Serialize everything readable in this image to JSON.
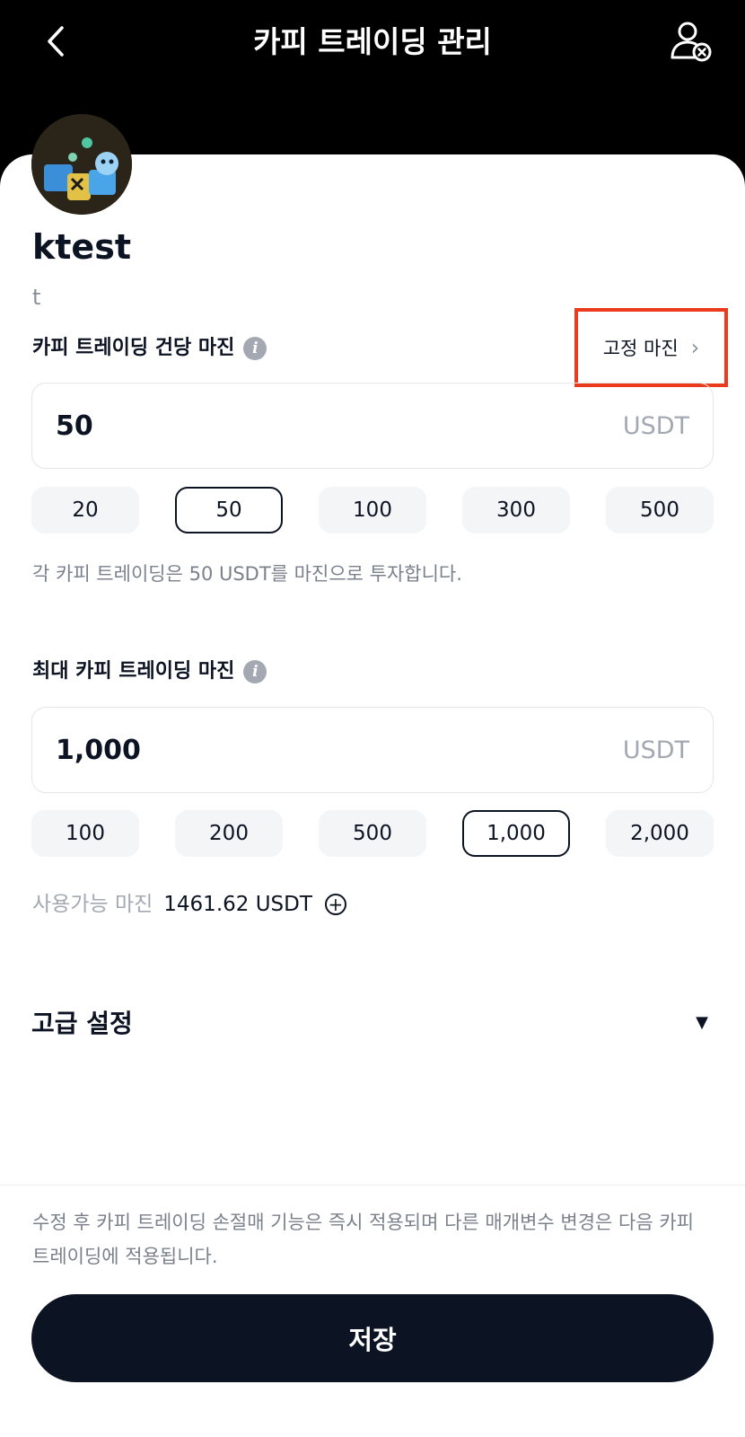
{
  "header": {
    "title": "카피 트레이딩 관리",
    "back_icon": "chevron-left-icon",
    "unfollow_icon": "user-remove-icon"
  },
  "trader": {
    "name": "ktest",
    "description": "t"
  },
  "per_trade_margin": {
    "label": "카피 트레이딩 건당 마진",
    "mode": "고정 마진",
    "value": "50",
    "unit": "USDT",
    "presets": [
      "20",
      "50",
      "100",
      "300",
      "500"
    ],
    "selected": "50",
    "helper": "각 카피 트레이딩은 50 USDT를 마진으로 투자합니다."
  },
  "max_margin": {
    "label": "최대 카피 트레이딩 마진",
    "value": "1,000",
    "unit": "USDT",
    "presets": [
      "100",
      "200",
      "500",
      "1,000",
      "2,000"
    ],
    "selected": "1,000"
  },
  "available": {
    "label": "사용가능 마진",
    "value": "1461.62 USDT"
  },
  "advanced": {
    "label": "고급 설정"
  },
  "footer": {
    "notice": "수정 후 카피 트레이딩 손절매 기능은 즉시 적용되며 다른 매개변수 변경은 다음 카피 트레이딩에 적용됩니다.",
    "save_label": "저장"
  },
  "colors": {
    "primary": "#0c1322",
    "highlight_border": "#ec3a1c",
    "muted": "#a3a8b2"
  }
}
